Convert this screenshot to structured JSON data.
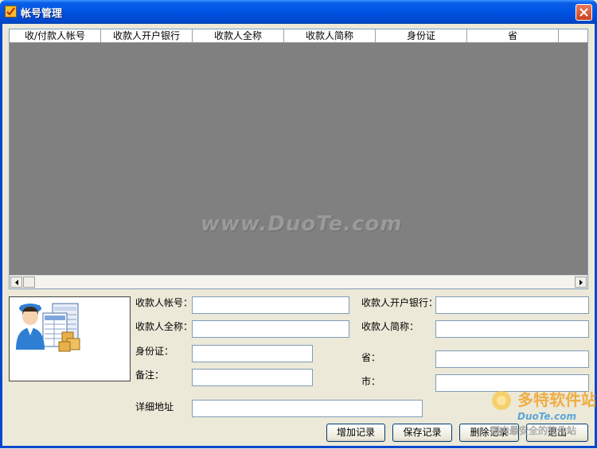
{
  "window": {
    "title": "帐号管理"
  },
  "grid": {
    "columns": [
      "收/付款人帐号",
      "收款人开户银行",
      "收款人全称",
      "收款人简称",
      "身份证",
      "省",
      ""
    ],
    "watermark": "www.DuoTe.com"
  },
  "form": {
    "payee_account_label": "收款人帐号：",
    "payee_account_value": "",
    "payee_bank_label": "收款人开户银行：",
    "payee_bank_value": "",
    "payee_fullname_label": "收款人全称：",
    "payee_fullname_value": "",
    "payee_shortname_label": "收款人简称：",
    "payee_shortname_value": "",
    "id_card_label": "身份证：",
    "id_card_value": "",
    "province_label": "省：",
    "province_value": "",
    "remark_label": "备注：",
    "remark_value": "",
    "city_label": "市：",
    "city_value": "",
    "address_label": "详细地址",
    "address_value": ""
  },
  "buttons": {
    "add": "增加记录",
    "save": "保存记录",
    "delete": "删除记录",
    "exit": "退出"
  },
  "brand_watermark": {
    "name": "多特软件站",
    "site": "DuoTe.com",
    "slogan": "国内最安全的软件站"
  }
}
